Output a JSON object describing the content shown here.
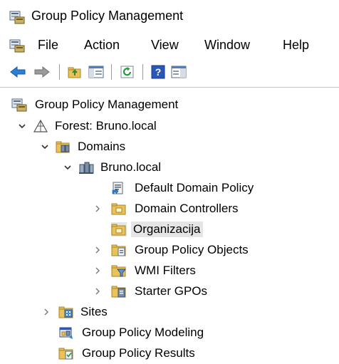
{
  "window": {
    "title": "Group Policy Management"
  },
  "menu": {
    "items": [
      "File",
      "Action",
      "View",
      "Window",
      "Help"
    ]
  },
  "toolbar": {
    "buttons": [
      "back-arrow-icon",
      "forward-arrow-icon",
      "up-folder-icon",
      "show-hide-tree-icon",
      "refresh-icon",
      "help-icon",
      "properties-pane-icon"
    ]
  },
  "tree": {
    "items": [
      {
        "label": "Group Policy Management"
      },
      {
        "label": "Forest: Bruno.local"
      },
      {
        "label": "Domains"
      },
      {
        "label": "Bruno.local"
      },
      {
        "label": "Default Domain Policy"
      },
      {
        "label": "Domain Controllers"
      },
      {
        "label": "Organizacija"
      },
      {
        "label": "Group Policy Objects"
      },
      {
        "label": "WMI Filters"
      },
      {
        "label": "Starter GPOs"
      },
      {
        "label": "Sites"
      },
      {
        "label": "Group Policy Modeling"
      },
      {
        "label": "Group Policy Results"
      }
    ]
  }
}
